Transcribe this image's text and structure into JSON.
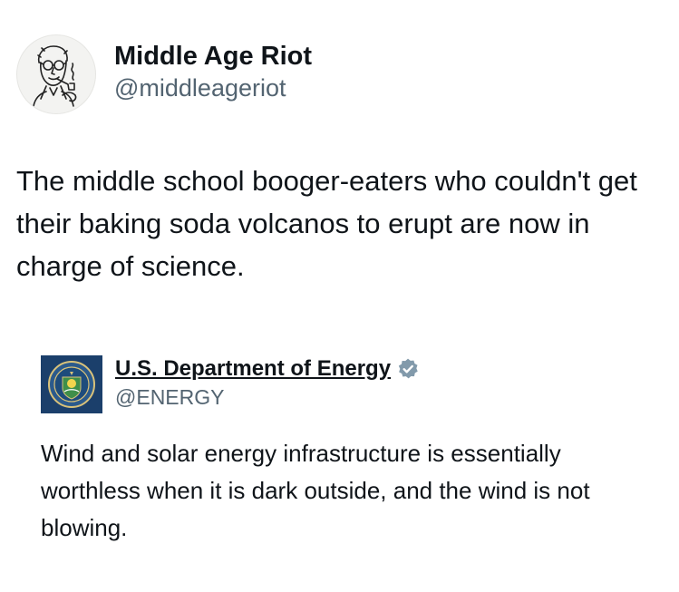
{
  "post": {
    "display_name": "Middle Age Riot",
    "handle": "@middleageriot",
    "text": "The middle school booger-eaters who couldn't get their baking soda volcanos to erupt are now in charge of science.",
    "avatar_icon": "retro-man-pipe-illustration"
  },
  "quoted_post": {
    "display_name": "U.S. Department of Energy",
    "handle": "@ENERGY",
    "verified": true,
    "verified_badge_color": "#829aab",
    "avatar_icon": "doe-seal-logo",
    "avatar_bg_color": "#1b3f6b",
    "text": "Wind and solar energy infrastructure is essentially worthless when it is dark outside, and the wind is not blowing."
  }
}
